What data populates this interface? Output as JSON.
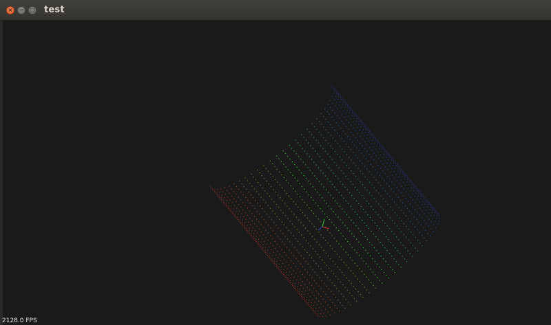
{
  "window": {
    "title": "test",
    "controls": [
      {
        "name": "close",
        "glyph": "×",
        "color": "#e25a27"
      },
      {
        "name": "minimize",
        "glyph": "−",
        "color": "#6b6a65"
      },
      {
        "name": "maximize",
        "glyph": "□",
        "color": "#6b6a65"
      }
    ]
  },
  "viewer": {
    "background": "#1a1a1a",
    "fps_text": "2128.0 FPS",
    "point_cloud": {
      "shape": "cylinder",
      "color_map": [
        "#c0392b",
        "#3cbf3c",
        "#2a3fb0"
      ]
    },
    "axes_colors": {
      "x": "#cc3333",
      "y": "#33cc33",
      "z": "#3344cc"
    }
  }
}
